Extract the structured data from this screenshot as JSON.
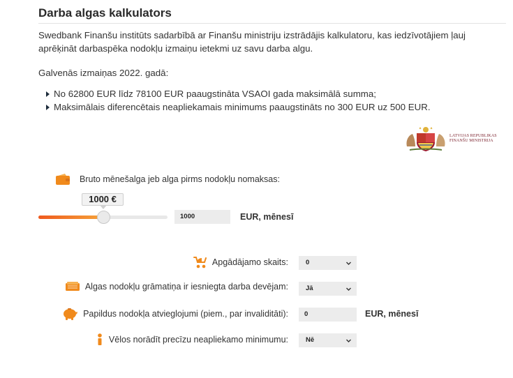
{
  "page": {
    "title": "Darba algas kalkulators",
    "intro": "Swedbank Finanšu institūts sadarbībā ar Finanšu ministriju izstrādājis kalkulatoru, kas iedzīvotājiem ļauj aprēķināt darbaspēka nodokļu izmaiņu ietekmi uz savu darba algu.",
    "changes_heading": "Galvenās izmaiņas 2022. gadā:",
    "changes": [
      "No 62800 EUR līdz 78100 EUR paaugstināta VSAOI gada maksimālā summa;",
      "Maksimālais diferencētais neapliekamais minimums paaugstināts no 300 EUR uz 500 EUR."
    ]
  },
  "logo": {
    "line1": "LATVIJAS REPUBLIKAS",
    "line2": "FINANŠU MINISTRIJA",
    "icon": "coat-of-arms-icon"
  },
  "salary": {
    "label": "Bruto mēnešalga jeb alga pirms nodokļu nomaksas:",
    "icon": "wallet-icon",
    "tooltip": "1000 €",
    "slider_fraction": 0.52,
    "value": "1000",
    "unit": "EUR, mēnesī"
  },
  "fields": {
    "dependents": {
      "label": "Apgādājamo skaits:",
      "icon": "stroller-icon",
      "value": "0"
    },
    "tax_book": {
      "label": "Algas nodokļu grāmatiņa ir iesniegta darba devējam:",
      "icon": "book-icon",
      "value": "Jā"
    },
    "extra_relief": {
      "label": "Papildus nodokļa atvieglojumi (piem., par invaliditāti):",
      "icon": "piggy-bank-icon",
      "value": "0",
      "unit": "EUR, mēnesī"
    },
    "exact_minimum": {
      "label": "Vēlos norādīt precīzu neapliekamo minimumu:",
      "icon": "info-person-icon",
      "value": "Nē"
    }
  },
  "colors": {
    "accent": "#f08a1c",
    "slider_start": "#ef5a1e",
    "slider_end": "#f6a53a",
    "heading": "#2a2a2a",
    "logo_text": "#7a1f2b"
  }
}
